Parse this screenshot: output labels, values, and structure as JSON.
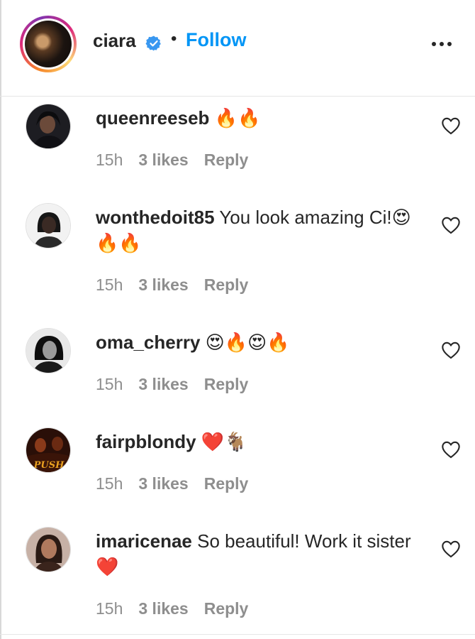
{
  "header": {
    "username": "ciara",
    "separator": "•",
    "follow_label": "Follow",
    "avatar_icon": "profile-photo-ciara",
    "verified_icon": "verified-badge-icon",
    "more_icon": "more-options-icon"
  },
  "colors": {
    "follow_blue": "#0095f6",
    "verified_blue": "#3897f0",
    "meta_gray": "#8e8e8e",
    "text_dark": "#262626"
  },
  "comments": [
    {
      "username": "queenreeseb",
      "text": "🔥🔥",
      "time": "15h",
      "likes": "3 likes",
      "reply": "Reply"
    },
    {
      "username": "wonthedoit85",
      "text": "You look amazing Ci!😍🔥🔥",
      "time": "15h",
      "likes": "3 likes",
      "reply": "Reply"
    },
    {
      "username": "oma_cherry",
      "text": "😍🔥😍🔥",
      "time": "15h",
      "likes": "3 likes",
      "reply": "Reply"
    },
    {
      "username": "fairpblondy",
      "text": "❤️🐐",
      "time": "15h",
      "likes": "3 likes",
      "reply": "Reply"
    },
    {
      "username": "imaricenae",
      "text": "So beautiful! Work it sister ❤️",
      "time": "15h",
      "likes": "3 likes",
      "reply": "Reply"
    }
  ],
  "avatar_labels": {
    "comment_3": "PUSH"
  }
}
